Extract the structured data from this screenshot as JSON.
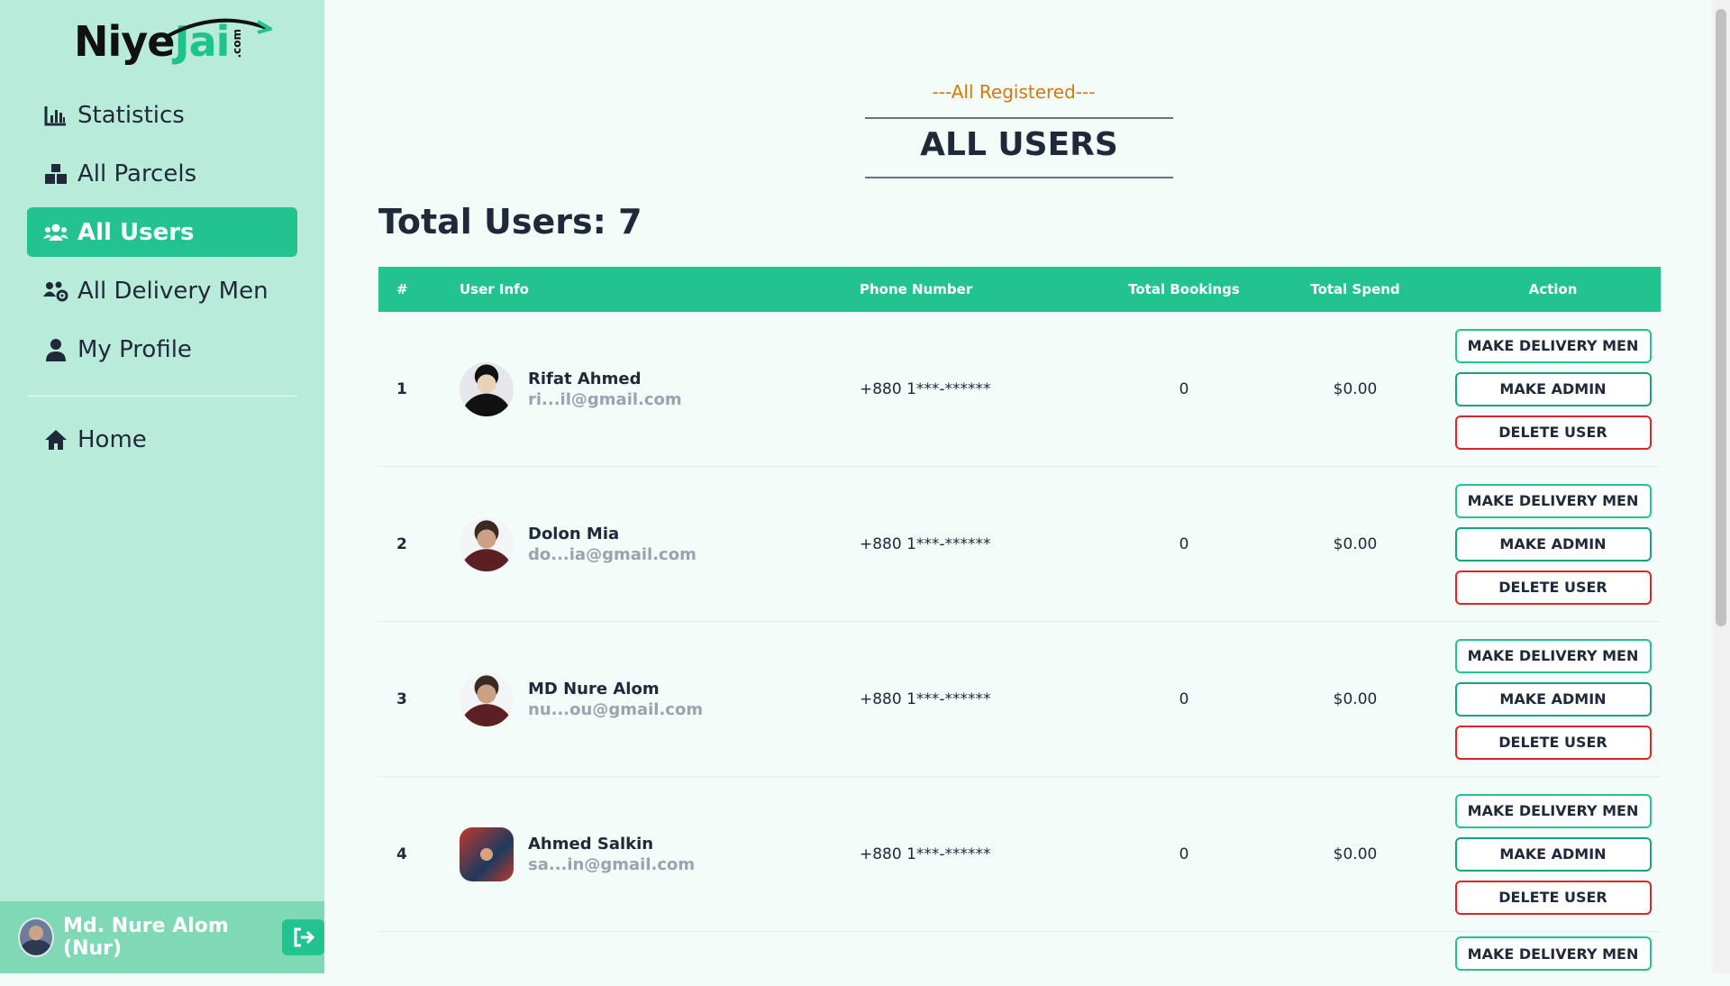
{
  "brand": {
    "name_part1": "Niye",
    "name_part2": "Jai",
    "suffix": ".com"
  },
  "sidebar": {
    "items": [
      {
        "label": "Statistics",
        "icon": "chart-bar-icon"
      },
      {
        "label": "All Parcels",
        "icon": "boxes-icon"
      },
      {
        "label": "All Users",
        "icon": "users-icon",
        "active": true
      },
      {
        "label": "All Delivery Men",
        "icon": "users-gear-icon"
      },
      {
        "label": "My Profile",
        "icon": "user-icon"
      }
    ],
    "home": {
      "label": "Home",
      "icon": "home-icon"
    },
    "footer": {
      "user_name": "Md. Nure Alom (Nur)",
      "logout_icon": "logout-icon"
    }
  },
  "header": {
    "subtitle": "---All Registered---",
    "title": "ALL USERS"
  },
  "summary": {
    "total_users": "Total Users: 7"
  },
  "table": {
    "columns": [
      "#",
      "User Info",
      "Phone Number",
      "Total Bookings",
      "Total Spend",
      "Action"
    ],
    "rows": [
      {
        "num": "1",
        "name": "Rifat Ahmed",
        "email": "ri...il@gmail.com",
        "phone": "+880 1***-******",
        "bookings": "0",
        "spend": "$0.00"
      },
      {
        "num": "2",
        "name": "Dolon Mia",
        "email": "do...ia@gmail.com",
        "phone": "+880 1***-******",
        "bookings": "0",
        "spend": "$0.00"
      },
      {
        "num": "3",
        "name": "MD Nure Alom",
        "email": "nu...ou@gmail.com",
        "phone": "+880 1***-******",
        "bookings": "0",
        "spend": "$0.00"
      },
      {
        "num": "4",
        "name": "Ahmed Salkin",
        "email": "sa...in@gmail.com",
        "phone": "+880 1***-******",
        "bookings": "0",
        "spend": "$0.00"
      }
    ],
    "actions": {
      "delivery": "MAKE DELIVERY MEN",
      "admin": "MAKE ADMIN",
      "delete": "DELETE USER"
    }
  },
  "colors": {
    "accent": "#22c38e",
    "sidebar_bg": "#b8ebd9",
    "danger": "#dc2626",
    "subtitle": "#d97706"
  }
}
